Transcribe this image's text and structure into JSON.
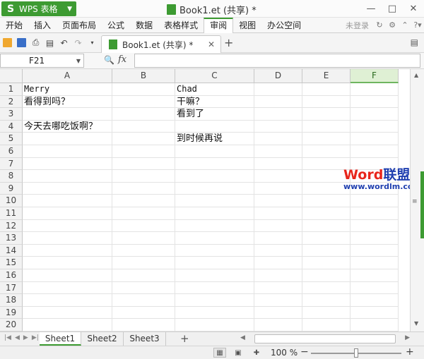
{
  "app": {
    "menu_button_label": "WPS 表格",
    "document_title": "Book1.et (共享) *"
  },
  "menu": {
    "items": [
      "开始",
      "插入",
      "页面布局",
      "公式",
      "数据",
      "表格样式",
      "审阅",
      "视图",
      "办公空间"
    ],
    "active_index": 6,
    "login_label": "未登录",
    "help_label": "?"
  },
  "toolbar": {
    "tab_label": "Book1.et (共享) *"
  },
  "formula_bar": {
    "cell_reference": "F21",
    "fx_label": "fx",
    "formula_value": ""
  },
  "grid": {
    "columns": [
      "A",
      "B",
      "C",
      "D",
      "E",
      "F"
    ],
    "selected_column": "F",
    "rows": [
      {
        "num": "1",
        "cells": [
          "Merry",
          "",
          "Chad",
          "",
          "",
          ""
        ]
      },
      {
        "num": "2",
        "cells": [
          "看得到吗？",
          "",
          "干嘛？",
          "",
          "",
          ""
        ]
      },
      {
        "num": "3",
        "cells": [
          "",
          "",
          "看到了",
          "",
          "",
          ""
        ]
      },
      {
        "num": "4",
        "cells": [
          "今天去哪吃饭啊？",
          "",
          "",
          "",
          "",
          ""
        ]
      },
      {
        "num": "5",
        "cells": [
          "",
          "",
          "到时候再说",
          "",
          "",
          ""
        ]
      },
      {
        "num": "6",
        "cells": [
          "",
          "",
          "",
          "",
          "",
          ""
        ]
      },
      {
        "num": "7",
        "cells": [
          "",
          "",
          "",
          "",
          "",
          ""
        ]
      },
      {
        "num": "8",
        "cells": [
          "",
          "",
          "",
          "",
          "",
          ""
        ]
      },
      {
        "num": "9",
        "cells": [
          "",
          "",
          "",
          "",
          "",
          ""
        ]
      },
      {
        "num": "10",
        "cells": [
          "",
          "",
          "",
          "",
          "",
          ""
        ]
      },
      {
        "num": "11",
        "cells": [
          "",
          "",
          "",
          "",
          "",
          ""
        ]
      },
      {
        "num": "12",
        "cells": [
          "",
          "",
          "",
          "",
          "",
          ""
        ]
      },
      {
        "num": "13",
        "cells": [
          "",
          "",
          "",
          "",
          "",
          ""
        ]
      },
      {
        "num": "14",
        "cells": [
          "",
          "",
          "",
          "",
          "",
          ""
        ]
      },
      {
        "num": "15",
        "cells": [
          "",
          "",
          "",
          "",
          "",
          ""
        ]
      },
      {
        "num": "16",
        "cells": [
          "",
          "",
          "",
          "",
          "",
          ""
        ]
      },
      {
        "num": "17",
        "cells": [
          "",
          "",
          "",
          "",
          "",
          ""
        ]
      },
      {
        "num": "18",
        "cells": [
          "",
          "",
          "",
          "",
          "",
          ""
        ]
      },
      {
        "num": "19",
        "cells": [
          "",
          "",
          "",
          "",
          "",
          ""
        ]
      },
      {
        "num": "20",
        "cells": [
          "",
          "",
          "",
          "",
          "",
          ""
        ]
      }
    ]
  },
  "watermark": {
    "word_part": "Word",
    "cn_part": "联盟",
    "url": "www.wordlm.com"
  },
  "sheets": {
    "tabs": [
      "Sheet1",
      "Sheet2",
      "Sheet3"
    ],
    "active_index": 0
  },
  "status": {
    "zoom_level": "100 %"
  },
  "colors": {
    "accent": "#3d9b32",
    "watermark_word_red": "#e8261c",
    "watermark_blue": "#1f3fb0"
  }
}
